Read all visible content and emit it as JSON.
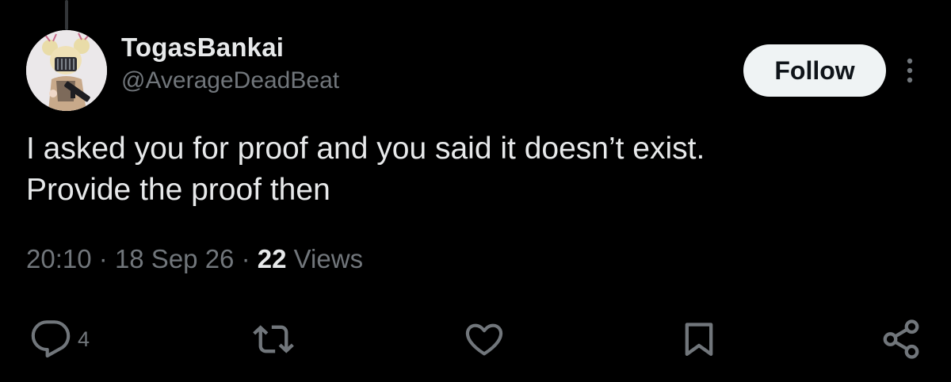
{
  "user": {
    "display_name": "TogasBankai",
    "handle": "@AverageDeadBeat",
    "avatar_icon": "anime-character-avatar"
  },
  "follow_label": "Follow",
  "tweet": {
    "text_line_1": "I asked you for proof and you said it doesn’t exist.",
    "text_line_2": "Provide the proof then"
  },
  "meta": {
    "time": "20:10",
    "separator": "·",
    "date": "18 Sep 26",
    "views_count": "22",
    "views_label": "Views"
  },
  "actions": {
    "reply_count": "4",
    "icons": [
      "reply-icon",
      "retweet-icon",
      "like-icon",
      "bookmark-icon",
      "share-icon"
    ]
  },
  "colors": {
    "background": "#000000",
    "text": "#e7e9ea",
    "secondary": "#71767b",
    "button_bg": "#eff3f4",
    "button_text": "#0f1419"
  }
}
